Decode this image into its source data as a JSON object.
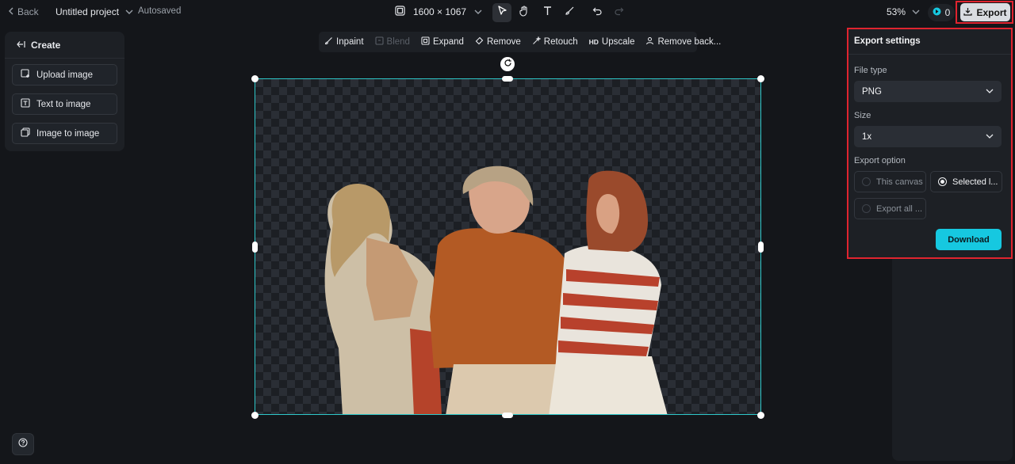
{
  "header": {
    "back_label": "Back",
    "project_name": "Untitled project",
    "save_status": "Autosaved",
    "canvas_size": "1600 × 1067",
    "zoom": "53%",
    "credits": "0",
    "export_label": "Export"
  },
  "left_panel": {
    "title": "Create",
    "items": [
      {
        "label": "Upload image"
      },
      {
        "label": "Text to image"
      },
      {
        "label": "Image to image"
      }
    ]
  },
  "context_toolbar": {
    "items": [
      {
        "label": "Inpaint",
        "enabled": true
      },
      {
        "label": "Blend",
        "enabled": false
      },
      {
        "label": "Expand",
        "enabled": true
      },
      {
        "label": "Remove",
        "enabled": true
      },
      {
        "label": "Retouch",
        "enabled": true
      },
      {
        "label": "Upscale",
        "enabled": true,
        "prefix": "HD"
      },
      {
        "label": "Remove back...",
        "enabled": true
      }
    ]
  },
  "export_panel": {
    "title": "Export settings",
    "file_type_label": "File type",
    "file_type_value": "PNG",
    "size_label": "Size",
    "size_value": "1x",
    "export_option_label": "Export option",
    "options": [
      {
        "label": "This canvas",
        "selected": false
      },
      {
        "label": "Selected l...",
        "selected": true
      },
      {
        "label": "Export all ...",
        "selected": false
      }
    ],
    "download_label": "Download"
  },
  "colors": {
    "accent": "#16c8e0",
    "selection": "#2ec7c9",
    "highlight": "#e0242f"
  }
}
